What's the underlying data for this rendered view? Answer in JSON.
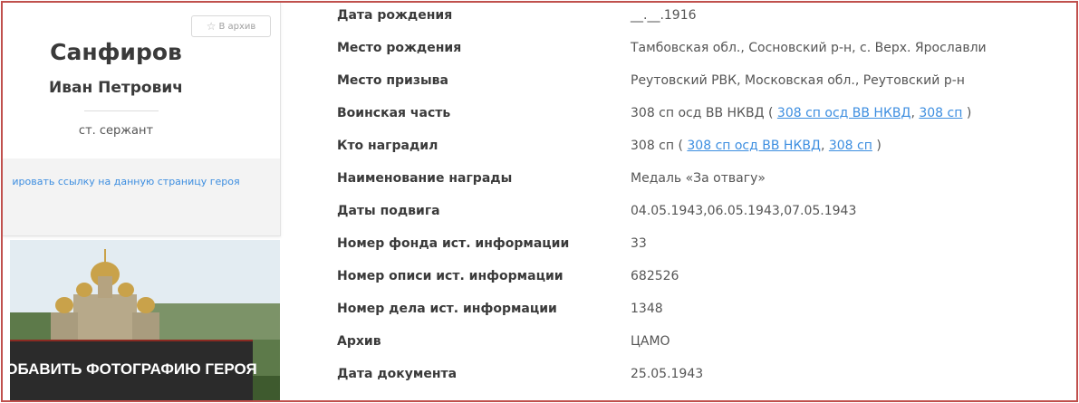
{
  "card": {
    "archive_button": "В архив",
    "surname": "Санфиров",
    "given_names": "Иван Петрович",
    "rank": "ст. сержант",
    "copy_link_text": "ировать ссылку на данную страницу героя"
  },
  "photo": {
    "add_photo_label": "ОБАВИТЬ ФОТОГРАФИЮ ГЕРОЯ"
  },
  "info": {
    "rows": [
      {
        "label": "Дата рождения",
        "value": "__.__.1916"
      },
      {
        "label": "Место рождения",
        "value": "Тамбовская обл., Сосновский р-н, с. Верх. Ярославли"
      },
      {
        "label": "Место призыва",
        "value": "Реутовский РВК, Московская обл., Реутовский р-н"
      },
      {
        "label": "Воинская часть",
        "value_prefix": "308 сп осд ВВ НКВД ( ",
        "link1": "308 сп осд ВВ НКВД",
        "sep": ", ",
        "link2": "308 сп",
        "value_suffix": " )"
      },
      {
        "label": "Кто наградил",
        "value_prefix": "308 сп ( ",
        "link1": "308 сп осд ВВ НКВД",
        "sep": ", ",
        "link2": "308 сп",
        "value_suffix": " )"
      },
      {
        "label": "Наименование награды",
        "value": "Медаль «За отвагу»"
      },
      {
        "label": "Даты подвига",
        "value": "04.05.1943,06.05.1943,07.05.1943"
      },
      {
        "label": "Номер фонда ист. информации",
        "value": "33"
      },
      {
        "label": "Номер описи ист. информации",
        "value": "682526"
      },
      {
        "label": "Номер дела ист. информации",
        "value": "1348"
      },
      {
        "label": "Архив",
        "value": "ЦАМО"
      },
      {
        "label": "Дата документа",
        "value": "25.05.1943"
      }
    ]
  },
  "colors": {
    "frame_border": "#c0504d",
    "link": "#3d8ee0",
    "label_text": "#3a3a3a",
    "value_text": "#555555"
  }
}
